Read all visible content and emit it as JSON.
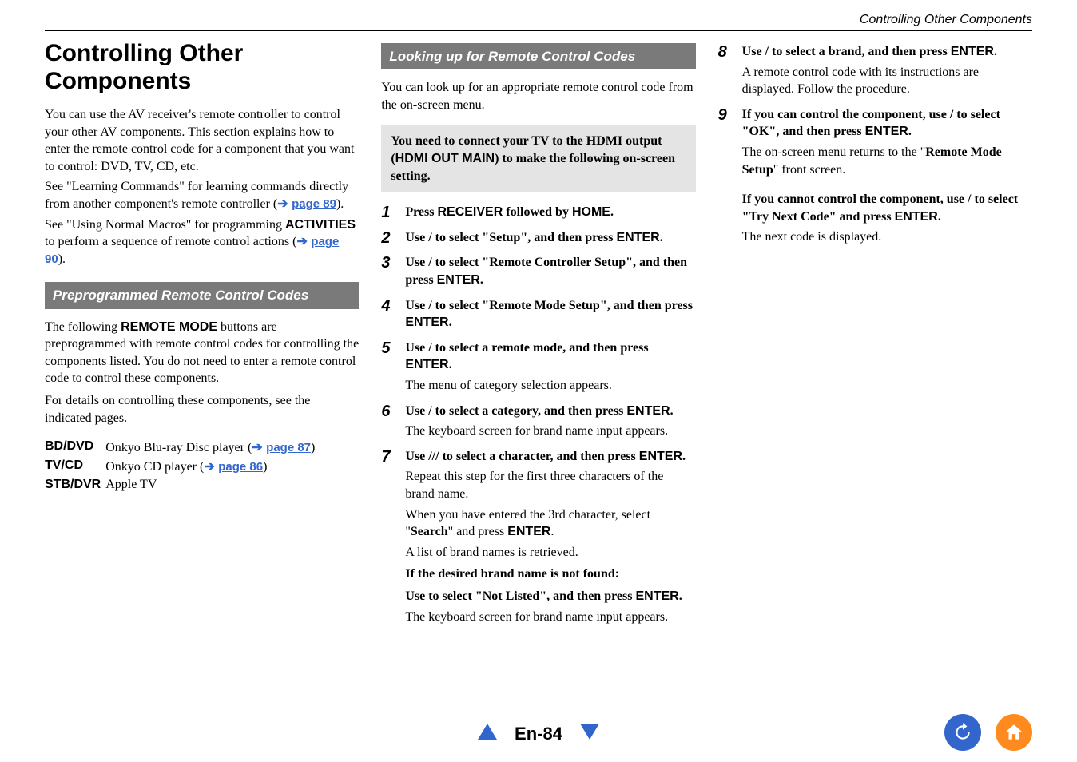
{
  "running_head": "Controlling Other Components",
  "title": "Controlling Other Components",
  "col1": {
    "intro1": "You can use the AV receiver's remote controller to control your other AV components. This section explains how to enter the remote control code for a component that you want to control: DVD, TV, CD, etc.",
    "intro2a": "See \"Learning Commands\" for learning commands directly from another component's remote controller (",
    "link89_arrow": "➔ ",
    "link89": "page 89",
    "intro2b": ").",
    "intro3a": "See \"Using Normal Macros\" for programming ",
    "activities": "ACTIVITIES",
    "intro3b": " to perform a sequence of remote control actions (",
    "link90_arrow": "➔ ",
    "link90": "page 90",
    "intro3c": ").",
    "section1": "Preprogrammed Remote Control Codes",
    "prep1a": "The following ",
    "remote_mode": "REMOTE MODE",
    "prep1b": " buttons are preprogrammed with remote control codes for controlling the components listed. You do not need to enter a remote control code to control these components.",
    "prep2": "For details on controlling these components, see the indicated pages.",
    "table": {
      "r1_label": "BD/DVD",
      "r1_text_a": "Onkyo Blu-ray Disc player (",
      "r1_link_arrow": "➔ ",
      "r1_link": "page 87",
      "r1_text_b": ")",
      "r2_label": "TV/CD",
      "r2_text_a": "Onkyo CD player (",
      "r2_link_arrow": "➔ ",
      "r2_link": "page 86",
      "r2_text_b": ")",
      "r3_label": "STB/DVR",
      "r3_text": "Apple TV"
    }
  },
  "col2": {
    "section": "Looking up for Remote Control Codes",
    "lead": "You can look up for an appropriate remote control code from the on-screen menu.",
    "note_a": "You need to connect your TV to the HDMI output (",
    "note_b": "HDMI OUT MAIN",
    "note_c": ") to make the following on-screen setting.",
    "s1_a": "Press ",
    "s1_b": "RECEIVER",
    "s1_c": " followed by ",
    "s1_d": "HOME",
    "s1_e": ".",
    "s2_a": "Use ",
    "s2_b": "/",
    "s2_c": " to select \"Setup\", and then press ",
    "s2_d": "ENTER",
    "s2_e": ".",
    "s3_a": "Use ",
    "s3_b": "/",
    "s3_c": " to select \"Remote Controller Setup\", and then press ",
    "s3_d": "ENTER",
    "s3_e": ".",
    "s4_a": "Use ",
    "s4_b": "/",
    "s4_c": " to select \"Remote Mode Setup\", and then press ",
    "s4_d": "ENTER",
    "s4_e": ".",
    "s5_a": "Use ",
    "s5_b": "/",
    "s5_c": " to select a remote mode, and then press ",
    "s5_d": "ENTER",
    "s5_e": ".",
    "s5_sub": "The menu of category selection appears.",
    "s6_a": "Use ",
    "s6_b": "/",
    "s6_c": " to select a category, and then press ",
    "s6_d": "ENTER",
    "s6_e": ".",
    "s6_sub": "The keyboard screen for brand name input appears.",
    "s7_a": "Use ",
    "s7_b": "/",
    "s7_c": "/",
    "s7_d": "/",
    "s7_e": " to select a character, and then press ",
    "s7_f": "ENTER",
    "s7_g": ".",
    "s7_sub1": "Repeat this step for the first three characters of the brand name.",
    "s7_sub2a": "When you have entered the 3rd character, select \"",
    "s7_sub2b": "Search",
    "s7_sub2c": "\" and press ",
    "s7_sub2d": "ENTER",
    "s7_sub2e": ".",
    "s7_sub3": "A list of brand names is retrieved.",
    "s7_sub4": "If the desired brand name is not found:",
    "s7_sub5a": "Use ",
    "s7_sub5b": " to select \"Not Listed\", and then press ",
    "s7_sub5c": "ENTER",
    "s7_sub5d": ".",
    "s7_sub6": "The keyboard screen for brand name input appears."
  },
  "col3": {
    "s8_a": "Use ",
    "s8_b": "/",
    "s8_c": " to select a brand, and then press ",
    "s8_d": "ENTER",
    "s8_e": ".",
    "s8_sub": "A remote control code with its instructions are displayed. Follow the procedure.",
    "s9_a": "If you can control the component, use ",
    "s9_b": "/",
    "s9_c": " to select \"OK\", and then press ",
    "s9_d": "ENTER",
    "s9_e": ".",
    "s9_sub_a": "The on-screen menu returns to the \"",
    "s9_sub_b": "Remote Mode Setup",
    "s9_sub_c": "\" front screen.",
    "s9_alt_a": "If you cannot control the component, use ",
    "s9_alt_b": "/",
    "s9_alt_c": " to select \"Try Next Code\" and press ",
    "s9_alt_d": "ENTER",
    "s9_alt_e": ".",
    "s9_alt_sub": "The next code is displayed."
  },
  "footer": {
    "page": "En-84"
  }
}
